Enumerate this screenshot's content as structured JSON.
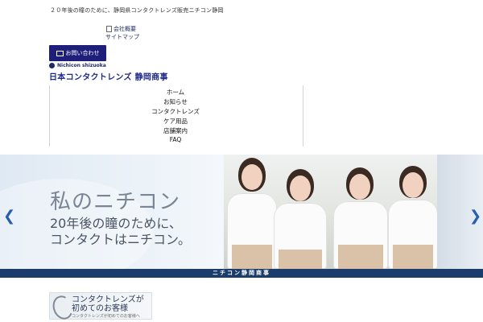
{
  "header": {
    "tagline": "２０年後の瞳のために、静岡県コンタクトレンズ販売ニチコン静岡",
    "links": [
      "会社概要",
      "サイトマップ"
    ],
    "contact_button": "お問い合わせ",
    "logo_en": "Nichicon shizuoka",
    "logo_ja": "日本コンタクトレンズ 静岡商事"
  },
  "nav": {
    "items": [
      "ホーム",
      "お知らせ",
      "コンタクトレンズ",
      "ケア用品",
      "店舗案内",
      "FAQ"
    ]
  },
  "hero": {
    "heading": "私のニチコン",
    "subheading_line1": "20年後の瞳のために、",
    "subheading_line2": "コンタクトはニチコン。",
    "prev_icon": "chevron-left-icon",
    "next_icon": "chevron-right-icon",
    "banner": "ニチコン静岡商事"
  },
  "first_time_card": {
    "line1": "コンタクトレンズが",
    "line2": "初めてのお客様",
    "caption": "コンタクトレンズが初めてのお客様へ"
  },
  "colors": {
    "brand_navy": "#1e1f7a",
    "banner_blue": "#1b3d6b",
    "arrow_blue": "#2a5db0"
  }
}
